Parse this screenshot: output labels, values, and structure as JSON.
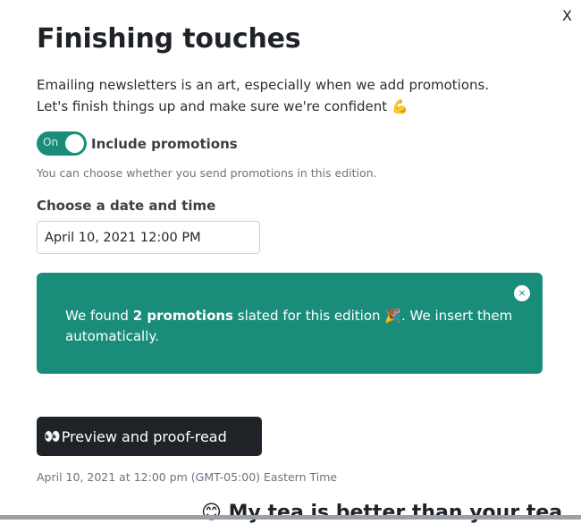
{
  "close_label": "X",
  "title": "Finishing touches",
  "intro": {
    "line1": "Emailing newsletters is an art, especially when we add promotions.",
    "line2": "Let's finish things up and make sure we're confident",
    "line2_emoji": "💪"
  },
  "toggle": {
    "state_label": "On",
    "label": "Include promotions",
    "on": true
  },
  "helper": "You can choose whether you send promotions in this edition.",
  "date": {
    "label": "Choose a date and time",
    "value": "April 10, 2021 12:00 PM"
  },
  "alert": {
    "prefix": "We found ",
    "count": "2 promotions",
    "middle": " slated for this edition ",
    "emoji": "🎉",
    "suffix": ". We insert them automatically.",
    "close_label": "×"
  },
  "preview_button": {
    "emoji": "👀",
    "label": "Preview and proof-read"
  },
  "schedule_note": "April 10, 2021 at 12:00 pm (GMT-05:00) Eastern Time",
  "peek_text": {
    "emoji": "😊",
    "label": "My tea is better than your tea"
  },
  "colors": {
    "accent": "#1a8d7a",
    "button_dark": "#1f2328"
  }
}
